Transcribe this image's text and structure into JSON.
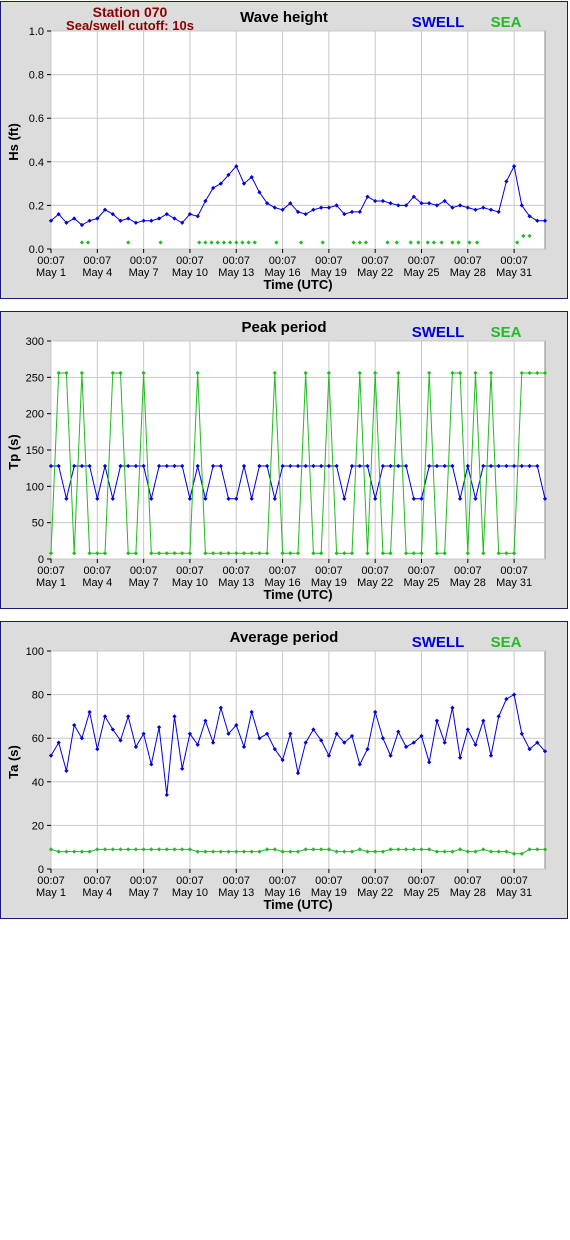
{
  "station": {
    "title": "Station 070",
    "cutoff": "Sea/swell cutoff: 10s"
  },
  "legend": {
    "swell_label": "SWELL",
    "sea_label": "SEA",
    "swell_color": "#0000dd",
    "sea_color": "#22bb22"
  },
  "x_axis": {
    "tick_time": "00:07",
    "tick_dates": [
      "May 1",
      "May 4",
      "May 7",
      "May 10",
      "May 13",
      "May 16",
      "May 19",
      "May 22",
      "May 25",
      "May 28",
      "May 31"
    ],
    "xlabel": "Time (UTC)"
  },
  "chart_data": [
    {
      "type": "line",
      "title": "Wave height",
      "ylabel": "Hs (ft)",
      "ylim": [
        0,
        1.0
      ],
      "yticks": [
        "0.0",
        "0.2",
        "0.4",
        "0.6",
        "0.8",
        "1.0"
      ],
      "xlim_days": [
        1,
        33
      ],
      "grid": true,
      "legend_position": "top-right",
      "series": [
        {
          "name": "SWELL",
          "x_day": [
            1,
            1.5,
            2,
            2.5,
            3,
            3.5,
            4,
            4.5,
            5,
            5.5,
            6,
            6.5,
            7,
            7.5,
            8,
            8.5,
            9,
            9.5,
            10,
            10.5,
            11,
            11.5,
            12,
            12.5,
            13,
            13.5,
            14,
            14.5,
            15,
            15.5,
            16,
            16.5,
            17,
            17.5,
            18,
            18.5,
            19,
            19.5,
            20,
            20.5,
            21,
            21.5,
            22,
            22.5,
            23,
            23.5,
            24,
            24.5,
            25,
            25.5,
            26,
            26.5,
            27,
            27.5,
            28,
            28.5,
            29,
            29.5,
            30,
            30.5,
            31,
            31.5,
            32,
            32.5,
            33
          ],
          "values": [
            0.13,
            0.16,
            0.12,
            0.14,
            0.11,
            0.13,
            0.14,
            0.18,
            0.16,
            0.13,
            0.14,
            0.12,
            0.13,
            0.13,
            0.14,
            0.16,
            0.14,
            0.12,
            0.16,
            0.15,
            0.22,
            0.28,
            0.3,
            0.34,
            0.38,
            0.3,
            0.33,
            0.26,
            0.21,
            0.19,
            0.18,
            0.21,
            0.17,
            0.16,
            0.18,
            0.19,
            0.19,
            0.2,
            0.16,
            0.17,
            0.17,
            0.24,
            0.22,
            0.22,
            0.21,
            0.2,
            0.2,
            0.24,
            0.21,
            0.21,
            0.2,
            0.22,
            0.19,
            0.2,
            0.19,
            0.18,
            0.19,
            0.18,
            0.17,
            0.31,
            0.38,
            0.2,
            0.15,
            0.13,
            0.13
          ]
        },
        {
          "name": "SEA",
          "x_day": [
            3,
            3.4,
            6,
            8.1,
            10.6,
            11,
            11.4,
            11.8,
            12.2,
            12.6,
            13,
            13.4,
            13.8,
            14.2,
            15.6,
            17.2,
            18.6,
            20.6,
            21,
            21.4,
            22.8,
            23.4,
            24.3,
            24.8,
            25.4,
            25.8,
            26.3,
            27,
            27.4,
            28.1,
            28.6,
            31.2,
            31.6,
            32
          ],
          "values": [
            0.03,
            0.03,
            0.03,
            0.03,
            0.03,
            0.03,
            0.03,
            0.03,
            0.03,
            0.03,
            0.03,
            0.03,
            0.03,
            0.03,
            0.03,
            0.03,
            0.03,
            0.03,
            0.03,
            0.03,
            0.03,
            0.03,
            0.03,
            0.03,
            0.03,
            0.03,
            0.03,
            0.03,
            0.03,
            0.03,
            0.03,
            0.03,
            0.06,
            0.06
          ]
        }
      ]
    },
    {
      "type": "line",
      "title": "Peak period",
      "ylabel": "Tp (s)",
      "ylim": [
        0,
        300
      ],
      "yticks": [
        "0",
        "50",
        "100",
        "150",
        "200",
        "250",
        "300"
      ],
      "xlim_days": [
        1,
        33
      ],
      "grid": true,
      "legend_position": "top-right",
      "series": [
        {
          "name": "SWELL",
          "x_day": [
            1,
            1.5,
            2,
            2.5,
            3,
            3.5,
            4,
            4.5,
            5,
            5.5,
            6,
            6.5,
            7,
            7.5,
            8,
            8.5,
            9,
            9.5,
            10,
            10.5,
            11,
            11.5,
            12,
            12.5,
            13,
            13.5,
            14,
            14.5,
            15,
            15.5,
            16,
            16.5,
            17,
            17.5,
            18,
            18.5,
            19,
            19.5,
            20,
            20.5,
            21,
            21.5,
            22,
            22.5,
            23,
            23.5,
            24,
            24.5,
            25,
            25.5,
            26,
            26.5,
            27,
            27.5,
            28,
            28.5,
            29,
            29.5,
            30,
            30.5,
            31,
            31.5,
            32,
            32.5,
            33
          ],
          "values": [
            128,
            128,
            83,
            128,
            128,
            128,
            83,
            128,
            83,
            128,
            128,
            128,
            128,
            83,
            128,
            128,
            128,
            128,
            83,
            128,
            83,
            128,
            128,
            83,
            83,
            128,
            83,
            128,
            128,
            83,
            128,
            128,
            128,
            128,
            128,
            128,
            128,
            128,
            83,
            128,
            128,
            128,
            83,
            128,
            128,
            128,
            128,
            83,
            83,
            128,
            128,
            128,
            128,
            83,
            128,
            83,
            128,
            128,
            128,
            128,
            128,
            128,
            128,
            128,
            83
          ]
        },
        {
          "name": "SEA",
          "x_day": [
            1,
            1.5,
            2,
            2.5,
            3,
            3.5,
            4,
            4.5,
            5,
            5.5,
            6,
            6.5,
            7,
            7.5,
            8,
            8.5,
            9,
            9.5,
            10,
            10.5,
            11,
            11.5,
            12,
            12.5,
            13,
            13.5,
            14,
            14.5,
            15,
            15.5,
            16,
            16.5,
            17,
            17.5,
            18,
            18.5,
            19,
            19.5,
            20,
            20.5,
            21,
            21.5,
            22,
            22.5,
            23,
            23.5,
            24,
            24.5,
            25,
            25.5,
            26,
            26.5,
            27,
            27.5,
            28,
            28.5,
            29,
            29.5,
            30,
            30.5,
            31,
            31.5,
            32,
            32.5,
            33
          ],
          "values": [
            8,
            256,
            256,
            8,
            256,
            8,
            8,
            8,
            256,
            256,
            8,
            8,
            256,
            8,
            8,
            8,
            8,
            8,
            8,
            256,
            8,
            8,
            8,
            8,
            8,
            8,
            8,
            8,
            8,
            256,
            8,
            8,
            8,
            256,
            8,
            8,
            256,
            8,
            8,
            8,
            256,
            8,
            256,
            8,
            8,
            256,
            8,
            8,
            8,
            256,
            8,
            8,
            256,
            256,
            8,
            256,
            8,
            256,
            8,
            8,
            8,
            256,
            256,
            256,
            256
          ]
        }
      ]
    },
    {
      "type": "line",
      "title": "Average period",
      "ylabel": "Ta (s)",
      "ylim": [
        0,
        100
      ],
      "yticks": [
        "0",
        "20",
        "40",
        "60",
        "80",
        "100"
      ],
      "xlim_days": [
        1,
        33
      ],
      "grid": true,
      "legend_position": "top-right",
      "series": [
        {
          "name": "SWELL",
          "x_day": [
            1,
            1.5,
            2,
            2.5,
            3,
            3.5,
            4,
            4.5,
            5,
            5.5,
            6,
            6.5,
            7,
            7.5,
            8,
            8.5,
            9,
            9.5,
            10,
            10.5,
            11,
            11.5,
            12,
            12.5,
            13,
            13.5,
            14,
            14.5,
            15,
            15.5,
            16,
            16.5,
            17,
            17.5,
            18,
            18.5,
            19,
            19.5,
            20,
            20.5,
            21,
            21.5,
            22,
            22.5,
            23,
            23.5,
            24,
            24.5,
            25,
            25.5,
            26,
            26.5,
            27,
            27.5,
            28,
            28.5,
            29,
            29.5,
            30,
            30.5,
            31,
            31.5,
            32,
            32.5,
            33
          ],
          "values": [
            52,
            58,
            45,
            66,
            60,
            72,
            55,
            70,
            64,
            59,
            70,
            56,
            62,
            48,
            65,
            34,
            70,
            46,
            62,
            57,
            68,
            58,
            74,
            62,
            66,
            56,
            72,
            60,
            62,
            55,
            50,
            62,
            44,
            58,
            64,
            59,
            52,
            62,
            58,
            61,
            48,
            55,
            72,
            60,
            52,
            63,
            56,
            58,
            61,
            49,
            68,
            58,
            74,
            51,
            64,
            57,
            68,
            52,
            70,
            78,
            80,
            62,
            55,
            58,
            54
          ]
        },
        {
          "name": "SEA",
          "x_day": [
            1,
            1.5,
            2,
            2.5,
            3,
            3.5,
            4,
            4.5,
            5,
            5.5,
            6,
            6.5,
            7,
            7.5,
            8,
            8.5,
            9,
            9.5,
            10,
            10.5,
            11,
            11.5,
            12,
            12.5,
            13,
            13.5,
            14,
            14.5,
            15,
            15.5,
            16,
            16.5,
            17,
            17.5,
            18,
            18.5,
            19,
            19.5,
            20,
            20.5,
            21,
            21.5,
            22,
            22.5,
            23,
            23.5,
            24,
            24.5,
            25,
            25.5,
            26,
            26.5,
            27,
            27.5,
            28,
            28.5,
            29,
            29.5,
            30,
            30.5,
            31,
            31.5,
            32,
            32.5,
            33
          ],
          "values": [
            9,
            8,
            8,
            8,
            8,
            8,
            9,
            9,
            9,
            9,
            9,
            9,
            9,
            9,
            9,
            9,
            9,
            9,
            9,
            8,
            8,
            8,
            8,
            8,
            8,
            8,
            8,
            8,
            9,
            9,
            8,
            8,
            8,
            9,
            9,
            9,
            9,
            8,
            8,
            8,
            9,
            8,
            8,
            8,
            9,
            9,
            9,
            9,
            9,
            9,
            8,
            8,
            8,
            9,
            8,
            8,
            9,
            8,
            8,
            8,
            7,
            7,
            9,
            9,
            9
          ]
        }
      ]
    }
  ]
}
